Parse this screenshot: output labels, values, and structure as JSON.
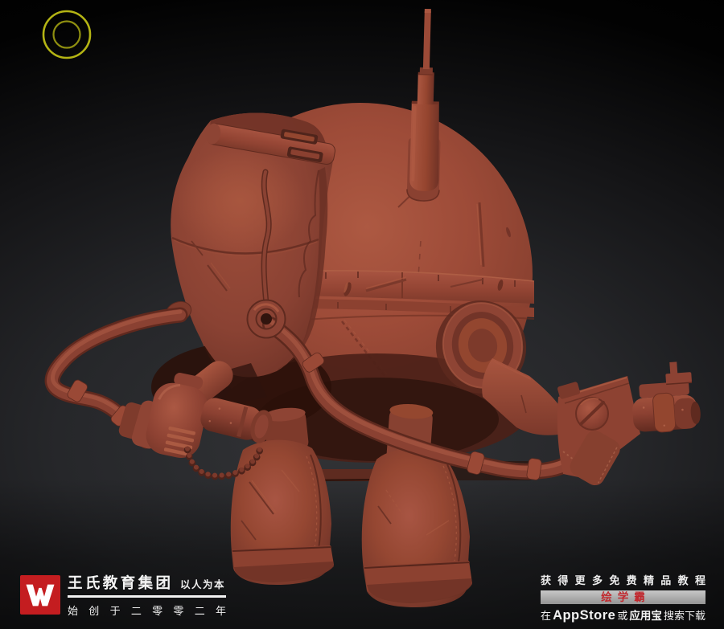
{
  "viewport": {
    "background_top": "#000000",
    "background_glow": "#323336"
  },
  "brush_cursor": {
    "outer_color": "#b4b414",
    "inner_color": "#8f8f10"
  },
  "model": {
    "subject": "chibi robot sculpt",
    "clay_base": "#9c4a37",
    "clay_light": "#ab5741",
    "clay_dark": "#6b3024"
  },
  "footer_left": {
    "logo_letter": "W",
    "logo_bg": "#c41d20",
    "company": "王氏教育集团",
    "slogan": "以人为本",
    "established": "始创于二零零二年"
  },
  "footer_right": {
    "promo": "获得更多免费精品教程",
    "app_name": "绘学霸",
    "dl_prefix": "在",
    "dl_store1": "AppStore",
    "dl_or": "或",
    "dl_store2": "应用宝",
    "dl_suffix": "搜索下载"
  }
}
